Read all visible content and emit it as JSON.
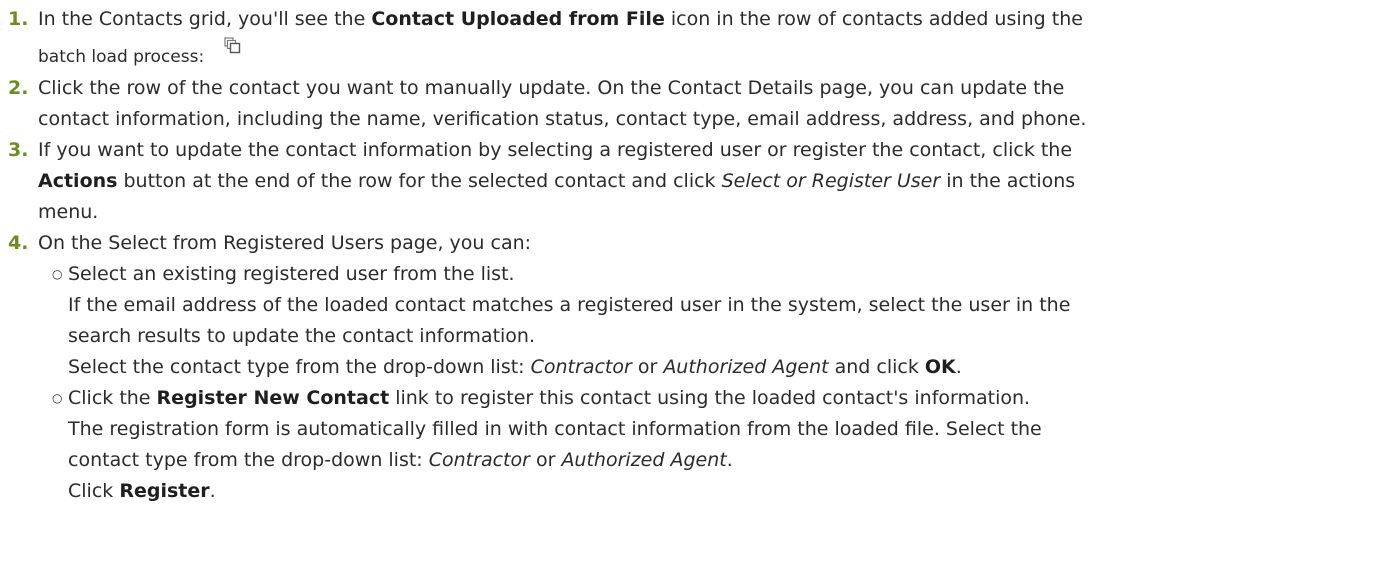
{
  "steps": [
    {
      "num": "1.",
      "line1_pre": "In the Contacts grid, you'll see the ",
      "line1_bold": "Contact Uploaded from File",
      "line1_post": " icon in the row of contacts added using the",
      "line2": "batch load process:",
      "icon": "copy-icon"
    },
    {
      "num": "2.",
      "line1": "Click the row of the contact you want to manually update. On the Contact Details page, you can update the",
      "line2": "contact information, including the name, verification status, contact type, email address, address, and phone."
    },
    {
      "num": "3.",
      "line1": "If you want to update the contact information by selecting a registered user or register the contact, click the",
      "line2_bold": "Actions",
      "line2_post": " button at the end of the row for the selected contact and click ",
      "line2_italic": "Select or Register User",
      "line2_tail": " in the actions",
      "line3": "menu."
    },
    {
      "num": "4.",
      "intro": "On the Select from Registered Users page, you can:",
      "bullets": [
        {
          "line1": "Select an existing registered user from the list.",
          "line2": "If the email address of the loaded contact matches a registered user in the system, select the user in the",
          "line3": "search results to update the contact information.",
          "line4_pre": "Select the contact type from the drop-down list: ",
          "opt1": "Contractor",
          "or": " or ",
          "opt2": "Authorized Agent",
          "line4_mid": " and click ",
          "ok": "OK",
          "line4_end": "."
        },
        {
          "line1_pre": "Click the ",
          "link": "Register New Contact",
          "line1_post": " link to register this contact using the loaded contact's information.",
          "line2": "The registration form is automatically filled in with contact information from the loaded file. Select the",
          "line3_pre": "contact type from the drop-down list: ",
          "opt1": "Contractor",
          "or": " or ",
          "opt2": "Authorized Agent",
          "line3_end": ".",
          "line4_pre": "Click ",
          "register": "Register",
          "line4_end": "."
        }
      ]
    }
  ]
}
